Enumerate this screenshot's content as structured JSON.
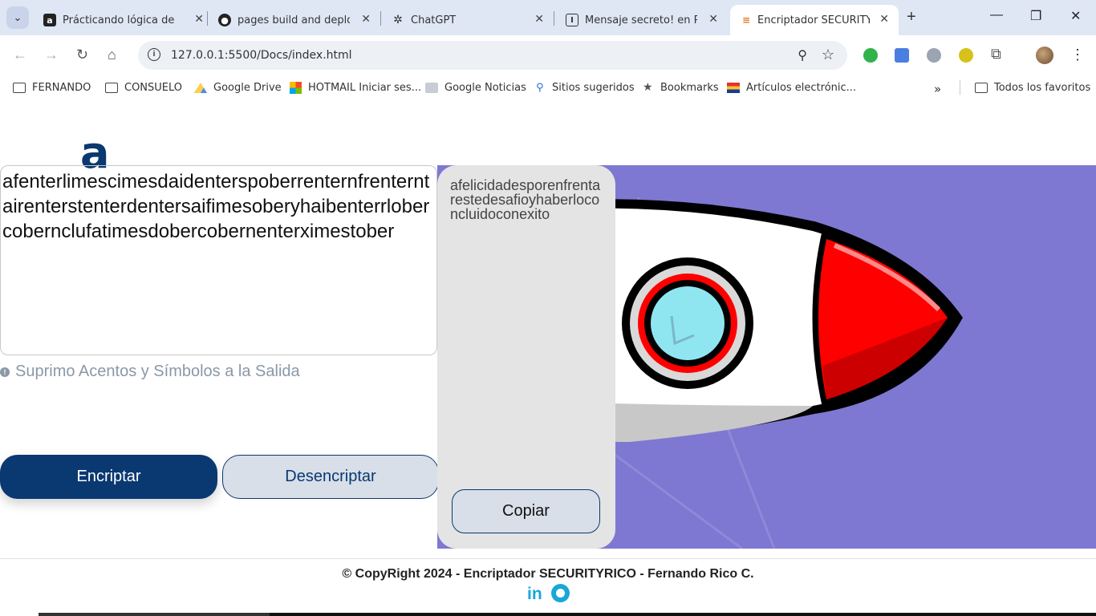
{
  "browser": {
    "tabs": [
      {
        "title": "Prácticando lógica de p",
        "favicon": "alura-icon"
      },
      {
        "title": "pages build and deploy",
        "favicon": "github-icon"
      },
      {
        "title": "ChatGPT",
        "favicon": "chatgpt-icon"
      },
      {
        "title": "Mensaje secreto! en Pro",
        "favicon": "hackathon-icon"
      },
      {
        "title": "Encriptador SECURITY-R",
        "favicon": "page-icon",
        "active": true
      }
    ],
    "url": "127.0.0.1:5500/Docs/index.html",
    "bookmarks": [
      "FERNANDO",
      "CONSUELO",
      "Google Drive",
      "HOTMAIL Iniciar ses...",
      "Google Noticias",
      "Sitios sugeridos",
      "Bookmarks",
      "Artículos electrónic...",
      "Todos los favoritos"
    ]
  },
  "app": {
    "logo": "a",
    "input_text": "afenterlimescimesdaidenterspoberrenternfrenterntairenterstenterdentersaifimesoberyhaibenterrlobercobernclufatimesdobercobernenterximestober",
    "hint": "Suprimo Acentos y Símbolos a la Salida",
    "encrypt_label": "Encriptar",
    "decrypt_label": "Desencriptar",
    "output_text": "afelicidadesporenfrentarestedesafioyhaberloconcluidoconexito",
    "copy_label": "Copiar",
    "footer_text": "© CopyRight 2024 - Encriptador SECURITYRICO - Fernando Rico C.",
    "linkedin": "in"
  },
  "colors": {
    "primary": "#0a3871",
    "art_bg": "#7e78d2",
    "rocket_nose": "#ff0000",
    "social": "#19a7d8"
  }
}
